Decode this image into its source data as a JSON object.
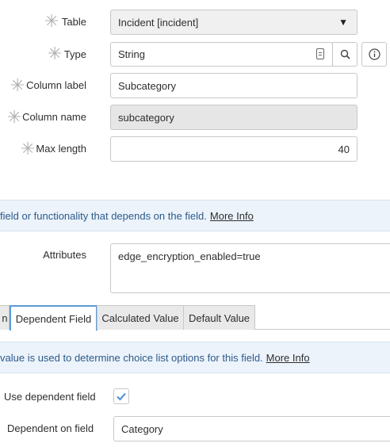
{
  "form": {
    "table": {
      "label": "Table",
      "value": "Incident [incident]"
    },
    "type": {
      "label": "Type",
      "value": "String"
    },
    "column_label": {
      "label": "Column label",
      "value": "Subcategory"
    },
    "column_name": {
      "label": "Column name",
      "value": "subcategory"
    },
    "max_length": {
      "label": "Max length",
      "value": "40"
    },
    "required_marker": "✳"
  },
  "notice1": {
    "text": "field or functionality that depends on the field.",
    "link": "More Info"
  },
  "attributes": {
    "label": "Attributes",
    "value": "edge_encryption_enabled=true"
  },
  "tabs": [
    {
      "label": "n"
    },
    {
      "label": "Dependent Field"
    },
    {
      "label": "Calculated Value"
    },
    {
      "label": "Default Value"
    }
  ],
  "notice2": {
    "text": "value is used to determine choice list options for this field.",
    "link": "More Info"
  },
  "dependent": {
    "use_label": "Use dependent field",
    "use_checked": true,
    "on_label": "Dependent on field",
    "on_value": "Category"
  },
  "colors": {
    "accent": "#5c9bd6",
    "notice_bg": "#ecf3fb",
    "notice_text": "#2d5a8a"
  },
  "icons": [
    "dropdown-arrow-icon",
    "copy-icon",
    "search-icon",
    "info-icon",
    "checkmark-icon"
  ]
}
